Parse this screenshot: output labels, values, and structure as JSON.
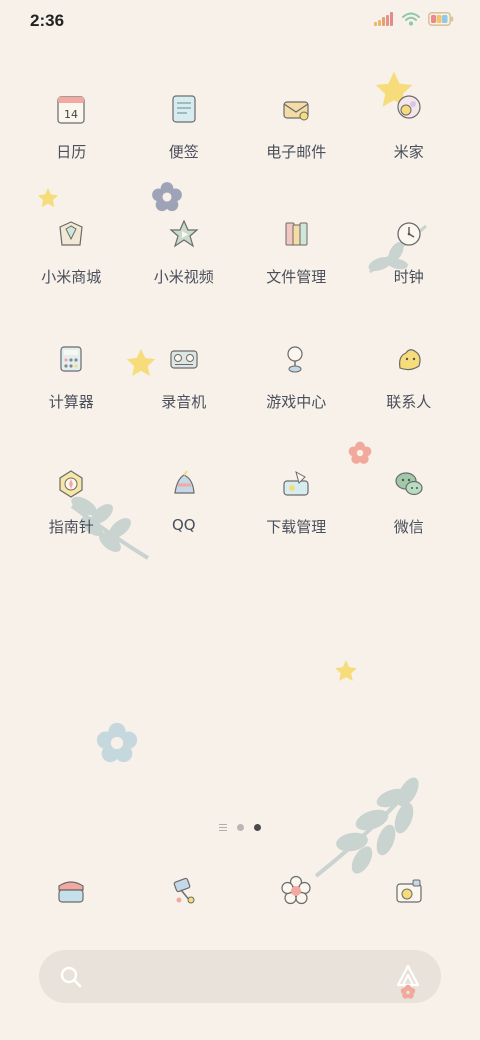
{
  "status_bar": {
    "time": "2:36",
    "signal_icon": "signal-bars-icon",
    "wifi_icon": "wifi-icon",
    "battery_icon": "battery-icon"
  },
  "apps": [
    {
      "label": "日历",
      "icon": "calendar-icon",
      "icon_text": "14"
    },
    {
      "label": "便签",
      "icon": "notes-icon"
    },
    {
      "label": "电子邮件",
      "icon": "email-icon"
    },
    {
      "label": "米家",
      "icon": "mijia-icon"
    },
    {
      "label": "小米商城",
      "icon": "mi-store-icon"
    },
    {
      "label": "小米视频",
      "icon": "mi-video-icon"
    },
    {
      "label": "文件管理",
      "icon": "file-manager-icon"
    },
    {
      "label": "时钟",
      "icon": "clock-icon"
    },
    {
      "label": "计算器",
      "icon": "calculator-icon"
    },
    {
      "label": "录音机",
      "icon": "recorder-icon"
    },
    {
      "label": "游戏中心",
      "icon": "game-center-icon"
    },
    {
      "label": "联系人",
      "icon": "contacts-icon"
    },
    {
      "label": "指南针",
      "icon": "compass-icon"
    },
    {
      "label": "QQ",
      "icon": "qq-icon"
    },
    {
      "label": "下载管理",
      "icon": "download-manager-icon"
    },
    {
      "label": "微信",
      "icon": "wechat-icon"
    }
  ],
  "page_indicator": {
    "pages": 2,
    "active": 2
  },
  "dock": [
    {
      "icon": "phone-icon"
    },
    {
      "icon": "messages-icon"
    },
    {
      "icon": "browser-icon"
    },
    {
      "icon": "camera-icon"
    }
  ],
  "search": {
    "search_icon": "search-icon",
    "voice_icon": "voice-assistant-icon"
  },
  "colors": {
    "background": "#f7f1ea",
    "label": "#4a4f5a",
    "search_bar": "#e8e2da",
    "star": "#f6dc7a",
    "leaf": "#c9d3cf"
  }
}
